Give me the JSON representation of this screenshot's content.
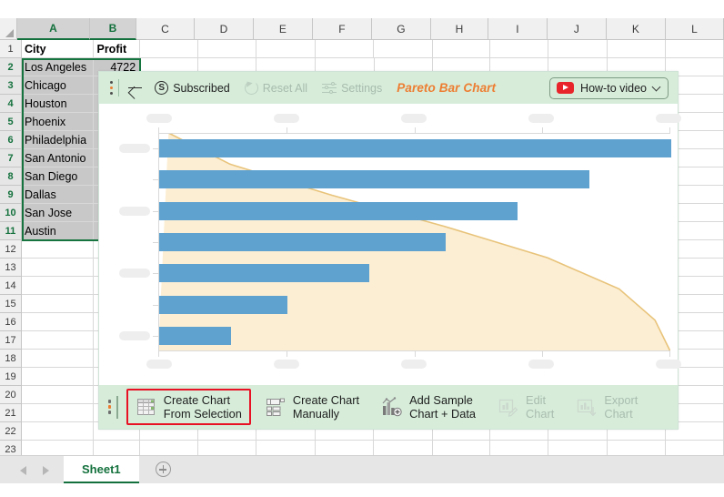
{
  "spreadsheet": {
    "columns": [
      "A",
      "B",
      "C",
      "D",
      "E",
      "F",
      "G",
      "H",
      "I",
      "J",
      "K",
      "L"
    ],
    "selected_columns": [
      "A",
      "B"
    ],
    "rows": [
      1,
      2,
      3,
      4,
      5,
      6,
      7,
      8,
      9,
      10,
      11,
      12,
      13,
      14,
      15,
      16,
      17,
      18,
      19,
      20,
      21,
      22,
      23
    ],
    "selected_rows": [
      2,
      3,
      4,
      5,
      6,
      7,
      8,
      9,
      10,
      11
    ],
    "headers": {
      "a": "City",
      "b": "Profit"
    },
    "data": [
      {
        "city": "Los Angeles",
        "profit": "4722"
      },
      {
        "city": "Chicago",
        "profit": ""
      },
      {
        "city": "Houston",
        "profit": ""
      },
      {
        "city": "Phoenix",
        "profit": ""
      },
      {
        "city": "Philadelphia",
        "profit": ""
      },
      {
        "city": "San Antonio",
        "profit": ""
      },
      {
        "city": "San Diego",
        "profit": ""
      },
      {
        "city": "Dallas",
        "profit": ""
      },
      {
        "city": "San Jose",
        "profit": ""
      },
      {
        "city": "Austin",
        "profit": ""
      }
    ],
    "sheet_tab": "Sheet1",
    "add_sheet_label": "+"
  },
  "panel": {
    "title": "Pareto Bar Chart",
    "toolbar": {
      "back_icon": "back-arrow-icon",
      "kebab_icon": "kebab-menu-icon",
      "subscribed_label": "Subscribed",
      "subscribed_icon": "dollar-circle-icon",
      "reset_label": "Reset All",
      "reset_icon": "reset-circular-arrow-icon",
      "settings_label": "Settings",
      "settings_icon": "sliders-icon",
      "video_label": "How-to video",
      "video_icon": "youtube-play-icon",
      "video_chevron": "chevron-down-icon"
    },
    "actions": [
      {
        "label_line1": "Create Chart",
        "label_line2": "From Selection",
        "icon": "table-grid-icon",
        "enabled": true,
        "highlighted": true
      },
      {
        "label_line1": "Create Chart",
        "label_line2": "Manually",
        "icon": "form-list-icon",
        "enabled": true,
        "highlighted": false
      },
      {
        "label_line1": "Add Sample",
        "label_line2": "Chart + Data",
        "icon": "bar-chart-plus-icon",
        "enabled": true,
        "highlighted": false
      },
      {
        "label_line1": "Edit",
        "label_line2": "Chart",
        "icon": "chart-pencil-icon",
        "enabled": false,
        "highlighted": false
      },
      {
        "label_line1": "Export",
        "label_line2": "Chart",
        "icon": "chart-download-icon",
        "enabled": false,
        "highlighted": false
      }
    ]
  },
  "chart_data": {
    "type": "bar",
    "title": "",
    "subtitle": "",
    "xlabel": "",
    "ylabel": "",
    "orientation": "horizontal",
    "categories": [
      "",
      "",
      "",
      "",
      "",
      "",
      ""
    ],
    "values": [
      100,
      84,
      70,
      56,
      41,
      25,
      14
    ],
    "labels_state": "placeholder-skeleton",
    "x_tick_count": 5,
    "y_tick_count": 7,
    "y_label_placeholder_count": 5,
    "xlim": [
      0,
      100
    ],
    "grid": false,
    "legend": "none",
    "series": [
      {
        "name": "bars",
        "type": "bar",
        "color": "#5fa2d0",
        "values": [
          100,
          84,
          70,
          56,
          41,
          25,
          14
        ]
      },
      {
        "name": "cumulative",
        "type": "area",
        "line_color": "#e8c37a",
        "fill_color": "#fceed3",
        "values": [
          2,
          14,
          34,
          56,
          76,
          90,
          97,
          100
        ]
      }
    ]
  }
}
